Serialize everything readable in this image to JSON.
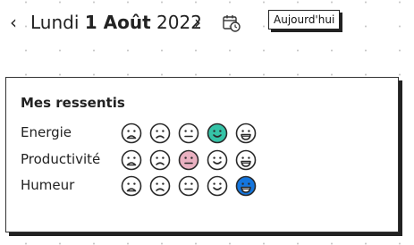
{
  "date_nav": {
    "prev_icon": "chevron-left",
    "prev_glyph": "‹",
    "day_name": "Lundi",
    "day_and_month": "1 Août",
    "year": "2022",
    "next_icon": "chevron-right",
    "next_glyph": "›",
    "calendar_icon": "calendar-clock-icon",
    "today_label": "Aujourd'hui"
  },
  "card": {
    "title": "Mes ressentis",
    "rows": [
      {
        "label": "Energie",
        "selected": 3,
        "selected_color": "#35c3a7"
      },
      {
        "label": "Productivité",
        "selected": 2,
        "selected_color": "#eab1c1"
      },
      {
        "label": "Humeur",
        "selected": 4,
        "selected_color": "#1476de"
      }
    ],
    "scale_icons": [
      "very-sad-face-icon",
      "sad-face-icon",
      "neutral-face-icon",
      "smile-face-icon",
      "big-grin-face-icon"
    ]
  },
  "colors": {
    "outline": "#2a2a2a",
    "energie_accent": "#35c3a7",
    "productivite_accent": "#eab1c1",
    "humeur_accent": "#1476de"
  }
}
